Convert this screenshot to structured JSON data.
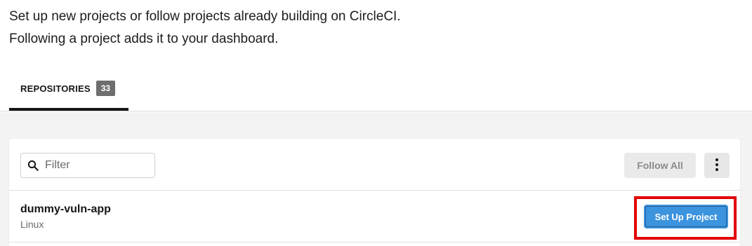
{
  "intro": {
    "line1": "Set up new projects or follow projects already building on CircleCI.",
    "line2": "Following a project adds it to your dashboard."
  },
  "tabs": [
    {
      "label": "REPOSITORIES",
      "count": "33",
      "active": true
    }
  ],
  "toolbar": {
    "filter_placeholder": "Filter",
    "filter_value": "",
    "follow_all_label": "Follow All",
    "more_icon": "vertical-ellipsis-icon",
    "search_icon": "search-icon"
  },
  "projects": [
    {
      "name": "dummy-vuln-app",
      "os": "Linux",
      "action_label": "Set Up Project"
    }
  ],
  "colors": {
    "primary_button": "#3c93de",
    "highlight_box": "#e10000",
    "tab_count_bg": "#6e6e6e",
    "content_bg": "#f3f3f3"
  }
}
